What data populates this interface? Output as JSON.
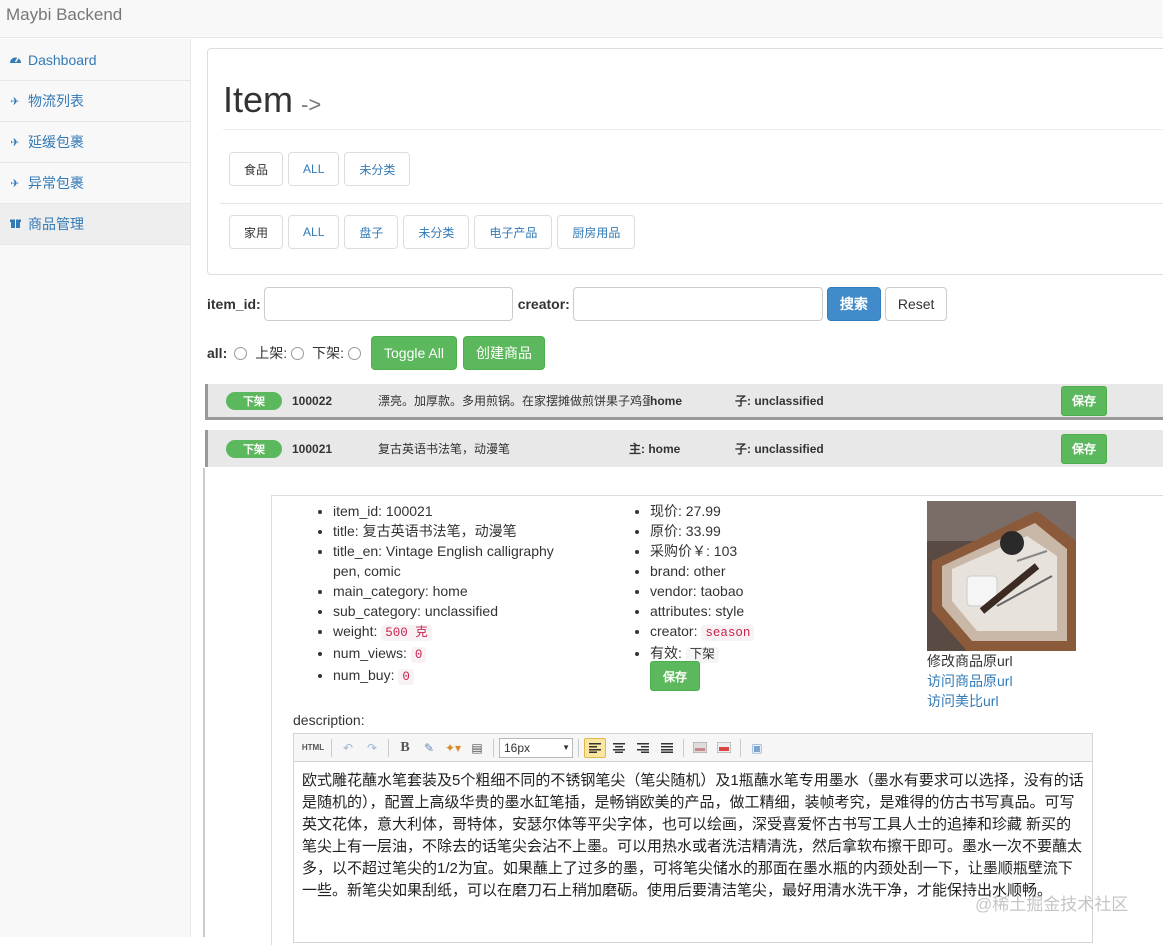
{
  "app": {
    "brand": "Maybi Backend"
  },
  "sidebar": {
    "items": [
      {
        "label": "Dashboard",
        "icon": "dashboard-icon"
      },
      {
        "label": "物流列表",
        "icon": "plane-icon"
      },
      {
        "label": "延缓包裹",
        "icon": "plane-icon"
      },
      {
        "label": "异常包裹",
        "icon": "plane-icon"
      },
      {
        "label": "商品管理",
        "icon": "gift-icon"
      }
    ]
  },
  "page": {
    "title": "Item",
    "subtitle": "->"
  },
  "categories": {
    "main": [
      "食品",
      "ALL",
      "未分类"
    ],
    "sub": [
      "家用",
      "ALL",
      "盘子",
      "未分类",
      "电子产品",
      "厨房用品"
    ]
  },
  "search": {
    "item_id_label": "item_id:",
    "item_id_value": "",
    "creator_label": "creator:",
    "creator_value": "",
    "search_button": "搜索",
    "reset_button": "Reset"
  },
  "filters": {
    "all_label": "all:",
    "on_label": "上架:",
    "off_label": "下架:",
    "toggle_all": "Toggle All",
    "create_item": "创建商品"
  },
  "items": [
    {
      "status": "下架",
      "id": "100022",
      "title": "漂亮。加厚款。多用煎锅。在家摆摊做煎饼果子鸡蛋",
      "main": "home",
      "main_prefix": "",
      "sub_prefix": "子:",
      "sub": "unclassified",
      "save": "保存"
    },
    {
      "status": "下架",
      "id": "100021",
      "title": "复古英语书法笔，动漫笔",
      "main_prefix": "主:",
      "main": "home",
      "sub_prefix": "子:",
      "sub": "unclassified",
      "save": "保存"
    }
  ],
  "detail": {
    "left": {
      "item_id": "item_id: 100021",
      "title": "title: 复古英语书法笔，动漫笔",
      "title_en_1": "title_en: Vintage English calligraphy",
      "title_en_2": "pen, comic",
      "main_category": "main_category: home",
      "sub_category": "sub_category: unclassified",
      "weight_label": "weight: ",
      "weight_value": "500 克",
      "num_views_label": "num_views: ",
      "num_views_value": "0",
      "num_buy_label": "num_buy: ",
      "num_buy_value": "0"
    },
    "right": {
      "price": "现价: 27.99",
      "orig_price": "原价: 33.99",
      "purchase_price": "采购价￥: 103",
      "brand": "brand: other",
      "vendor": "vendor: taobao",
      "attributes": "attributes: style",
      "creator_label": "creator: ",
      "creator_value": "season",
      "valid_label": "有效: ",
      "valid_value": "下架",
      "save": "保存"
    },
    "links": {
      "edit_url": "修改商品原url",
      "visit_url": "访问商品原url",
      "visit_maybi": "访问美比url"
    },
    "description_label": "description:",
    "editor": {
      "font_size": "16px",
      "html_btn": "HTML",
      "content": "欧式雕花蘸水笔套装及5个粗细不同的不锈钢笔尖（笔尖随机）及1瓶蘸水笔专用墨水（墨水有要求可以选择，没有的话是随机的），配置上高级华贵的墨水缸笔插，是畅销欧美的产品，做工精细，装帧考究，是难得的仿古书写真品。可写英文花体，意大利体，哥特体，安瑟尔体等平尖字体，也可以绘画，深受喜爱怀古书写工具人士的追捧和珍藏     新买的笔尖上有一层油，不除去的话笔尖会沾不上墨。可以用热水或者洗洁精清洗，然后拿软布擦干即可。墨水一次不要蘸太多，以不超过笔尖的1/2为宜。如果蘸上了过多的墨，可将笔尖储水的那面在墨水瓶的内颈处刮一下，让墨顺瓶壁流下一些。新笔尖如果刮纸，可以在磨刀石上稍加磨砺。使用后要清洁笔尖，最好用清水洗干净，才能保持出水顺畅。"
    }
  },
  "watermark": "@稀土掘金技术社区",
  "colors": {
    "primary": "#428bca",
    "success": "#5cb85c",
    "link": "#337ab7"
  }
}
